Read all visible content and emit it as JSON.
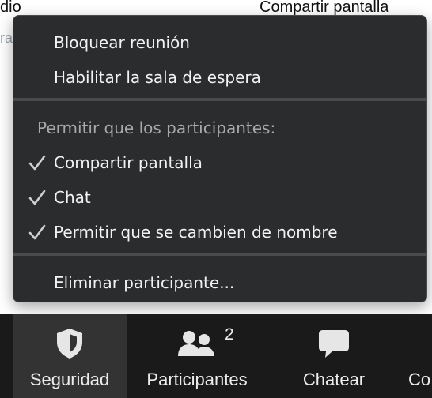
{
  "background": {
    "top_left_label": "dio",
    "top_right_label": "Compartir pantalla",
    "faint_label": "ra con"
  },
  "menu": {
    "items": [
      {
        "label": "Bloquear reunión"
      },
      {
        "label": "Habilitar la sala de espera"
      }
    ],
    "permissions_header": "Permitir que los participantes:",
    "permissions": [
      {
        "label": "Compartir pantalla",
        "checked": true
      },
      {
        "label": "Chat",
        "checked": true
      },
      {
        "label": "Permitir que se cambien de nombre",
        "checked": true
      }
    ],
    "remove_item": "Eliminar participante..."
  },
  "toolbar": {
    "buttons": [
      {
        "label": "Seguridad",
        "icon": "shield-icon",
        "active": true
      },
      {
        "label": "Participantes",
        "icon": "participants-icon",
        "count": "2"
      },
      {
        "label": "Chatear",
        "icon": "chat-bubble-icon"
      },
      {
        "label": "Co"
      }
    ]
  },
  "colors": {
    "menu_bg": "#2b2c2e",
    "toolbar_bg": "#1a1a1a",
    "active_button_bg": "#333334",
    "text": "#f2f2f2",
    "header_text": "#a9a9ab"
  }
}
